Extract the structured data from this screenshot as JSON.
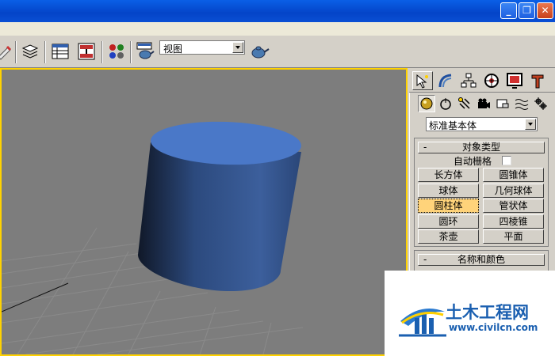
{
  "window": {
    "minimize_glyph": "_",
    "restore_glyph": "❐",
    "close_glyph": "✕"
  },
  "toolbar": {
    "view_dropdown_value": "视图"
  },
  "command_panel": {
    "category_dropdown_value": "标准基本体",
    "object_type_rollout": {
      "title": "对象类型",
      "collapse_glyph": "-",
      "autogrid_label": "自动栅格",
      "buttons": [
        "长方体",
        "圆锥体",
        "球体",
        "几何球体",
        "圆柱体",
        "管状体",
        "圆环",
        "四棱锥",
        "茶壶",
        "平面"
      ],
      "active_button": "圆柱体"
    },
    "name_color_rollout": {
      "title": "名称和颜色",
      "collapse_glyph": "-"
    }
  },
  "viewport": {
    "border_color": "#ffd200",
    "background_color": "#7d7d7d",
    "object_color": "#3f6ab0"
  },
  "watermark": {
    "title": "土木工程网",
    "url": "www.civilcn.com"
  },
  "icons": [
    "paint-icon",
    "layers-icon",
    "table-icon",
    "curve-editor-icon",
    "material-spheres-icon",
    "render-setup-teapot-icon",
    "quick-render-teapot-icon",
    "create-tab-icon",
    "modify-tab-icon",
    "hierarchy-tab-icon",
    "motion-tab-icon",
    "display-tab-icon",
    "utilities-tab-icon",
    "geometry-icon",
    "shapes-icon",
    "lights-icon",
    "cameras-icon",
    "helpers-icon",
    "spacewarps-icon",
    "systems-icon"
  ]
}
